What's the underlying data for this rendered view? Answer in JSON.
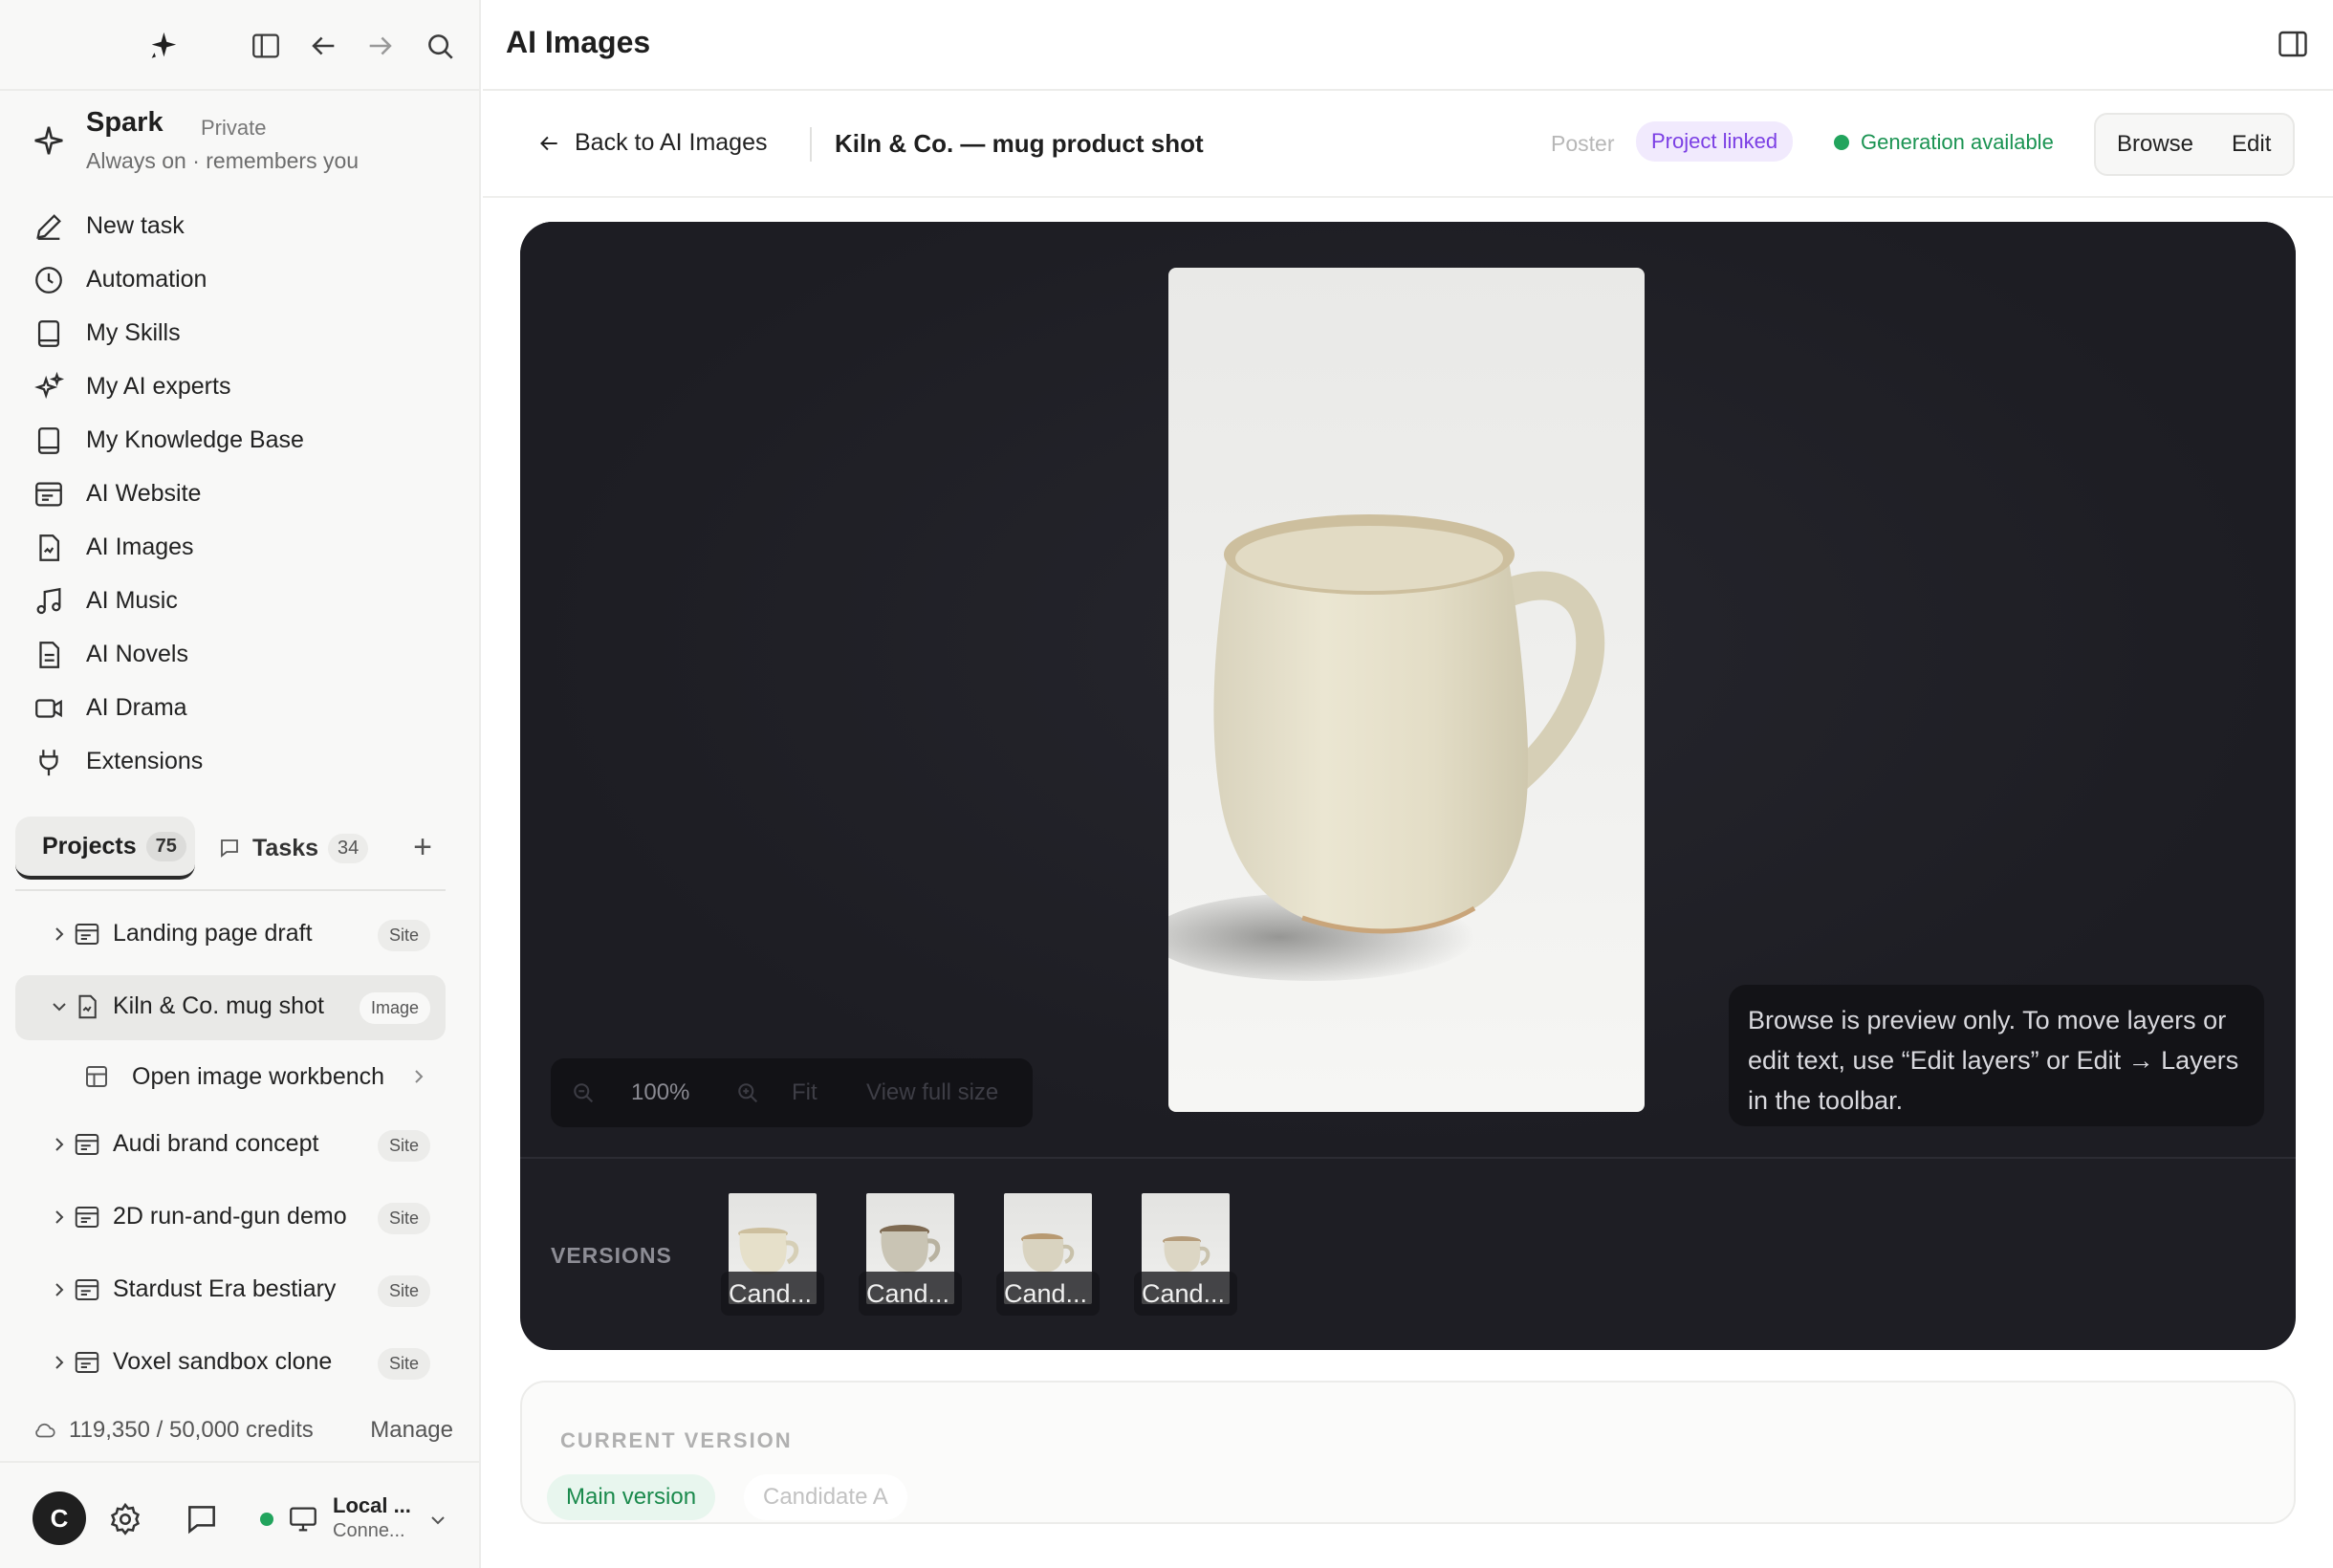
{
  "sidebar": {
    "account": {
      "name": "Spark",
      "visibility": "Private",
      "subtitle": "Always on · remembers you"
    },
    "nav": [
      {
        "label": "New task",
        "icon": "pencil-icon"
      },
      {
        "label": "Automation",
        "icon": "clock-icon"
      },
      {
        "label": "My Skills",
        "icon": "book-icon"
      },
      {
        "label": "My AI experts",
        "icon": "sparkles-icon"
      },
      {
        "label": "My Knowledge Base",
        "icon": "book-icon"
      },
      {
        "label": "AI Website",
        "icon": "browser-icon"
      },
      {
        "label": "AI Images",
        "icon": "image-file-icon"
      },
      {
        "label": "AI Music",
        "icon": "music-note-icon"
      },
      {
        "label": "AI Novels",
        "icon": "document-icon"
      },
      {
        "label": "AI Drama",
        "icon": "video-camera-icon"
      },
      {
        "label": "Extensions",
        "icon": "plug-icon"
      }
    ],
    "tabs": {
      "projects_label": "Projects",
      "projects_count": "75",
      "tasks_label": "Tasks",
      "tasks_count": "34"
    },
    "projects": [
      {
        "label": "Landing page draft",
        "badge": "Site"
      },
      {
        "label": "Kiln & Co. mug shot",
        "badge": "Image"
      },
      {
        "label": "Audi brand concept",
        "badge": "Site"
      },
      {
        "label": "2D run-and-gun demo",
        "badge": "Site"
      },
      {
        "label": "Stardust Era bestiary",
        "badge": "Site"
      },
      {
        "label": "Voxel sandbox clone",
        "badge": "Site"
      }
    ],
    "subitem": {
      "label": "Open image workbench"
    },
    "credits": {
      "text": "119,350 / 50,000 credits",
      "manage": "Manage"
    },
    "footer": {
      "avatar_letter": "C",
      "device_name": "Local ...",
      "device_status": "Conne..."
    }
  },
  "main": {
    "title": "AI Images",
    "back_label": "Back to AI Images",
    "doc_title": "Kiln & Co. — mug product shot",
    "poster_label": "Poster",
    "project_linked": "Project linked",
    "generation_status": "Generation available",
    "mode_browse": "Browse",
    "mode_edit": "Edit",
    "zoom": {
      "percent": "100%",
      "fit": "Fit",
      "full": "View full size"
    },
    "tip": "Browse is preview only. To move layers or edit text, use “Edit layers” or Edit → Layers in the toolbar.",
    "versions_label": "VERSIONS",
    "versions": [
      {
        "caption": "Cand..."
      },
      {
        "caption": "Cand..."
      },
      {
        "caption": "Cand..."
      },
      {
        "caption": "Cand..."
      }
    ],
    "current_version": {
      "label": "CURRENT VERSION",
      "main": "Main version",
      "candidate": "Candidate A"
    }
  },
  "colors": {
    "accent_green": "#22a45d",
    "accent_purple": "#7b3fe4",
    "stage_bg": "#1e1e24"
  }
}
